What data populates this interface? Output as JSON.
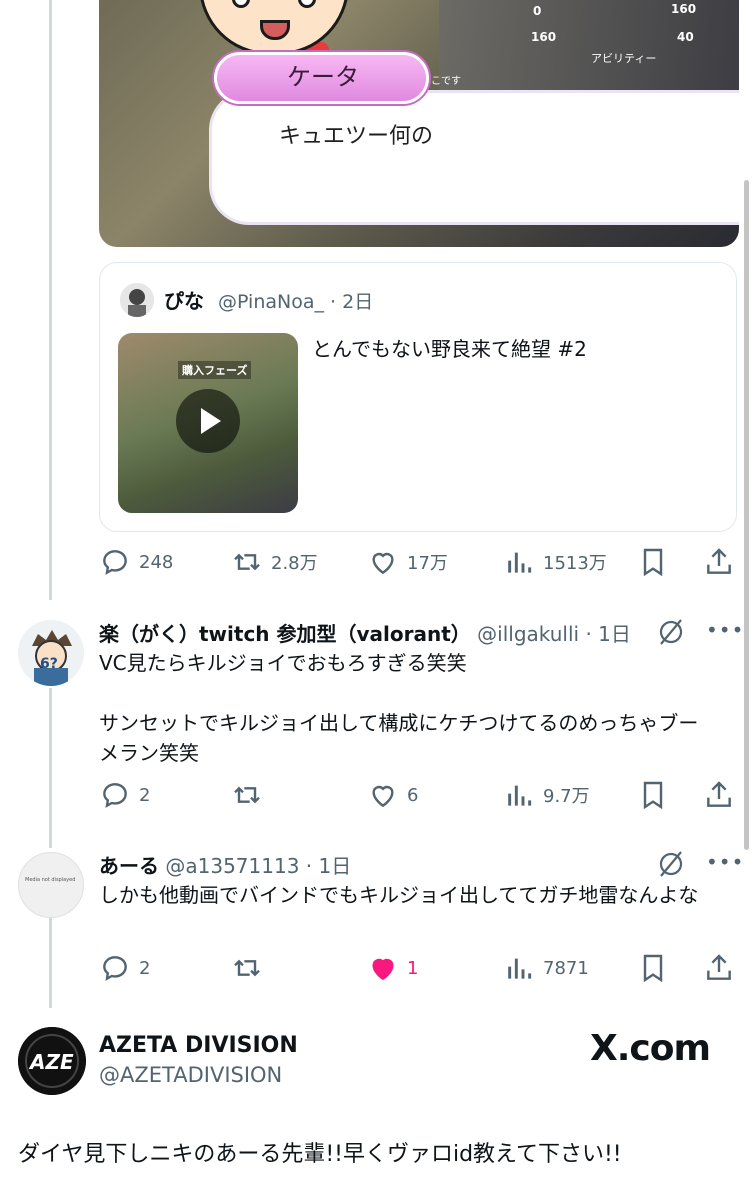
{
  "video": {
    "speaker_name": "ケータ",
    "subtitle": "キュエツー何の",
    "hud": {
      "score_a": "0",
      "score_b": "160",
      "score_c": "160",
      "score_d": "40",
      "ability_label": "アビリティー",
      "player_tag": "ねこです"
    }
  },
  "quote": {
    "name": "ぴな",
    "handle": "@PinaNoa_",
    "time": "2日",
    "text": "とんでもない野良来て絶望 #2",
    "thumb_label": "購入フェーズ"
  },
  "main_actions": {
    "replies": "248",
    "retweets": "2.8万",
    "likes": "17万",
    "views": "1513万"
  },
  "replies": [
    {
      "name": "楽（がく）twitch 参加型（valorant）",
      "handle": "@illgakulli",
      "time": "1日",
      "text_line1": "VC見たらキルジョイでおもろすぎる笑笑",
      "text_line2": "サンセットでキルジョイ出して構成にケチつけてるのめっちゃブーメラン笑笑",
      "replies": "2",
      "retweets": "",
      "likes": "6",
      "views": "9.7万"
    },
    {
      "name": "あーる",
      "handle": "@a13571113",
      "time": "1日",
      "text_line1": "しかも他動画でバインドでもキルジョイ出しててガチ地雷なんよな",
      "avatar_note": "Media not displayed",
      "replies": "2",
      "retweets": "",
      "likes": "1",
      "views": "7871"
    }
  ],
  "footer": {
    "name": "AZETA DIVISION",
    "handle": "@AZETADIVISION",
    "brand": "X.com",
    "logo_text": "AZE",
    "text": "ダイヤ見下しニキのあーる先輩!!早くヴァロid教えて下さい!!"
  },
  "colors": {
    "like_active": "#f91880",
    "muted_text": "#536471",
    "border": "#e1e8ed"
  },
  "icons": [
    "reply-icon",
    "retweet-icon",
    "like-icon",
    "views-icon",
    "bookmark-icon",
    "share-icon",
    "mute-icon",
    "grok-icon",
    "more-icon"
  ]
}
